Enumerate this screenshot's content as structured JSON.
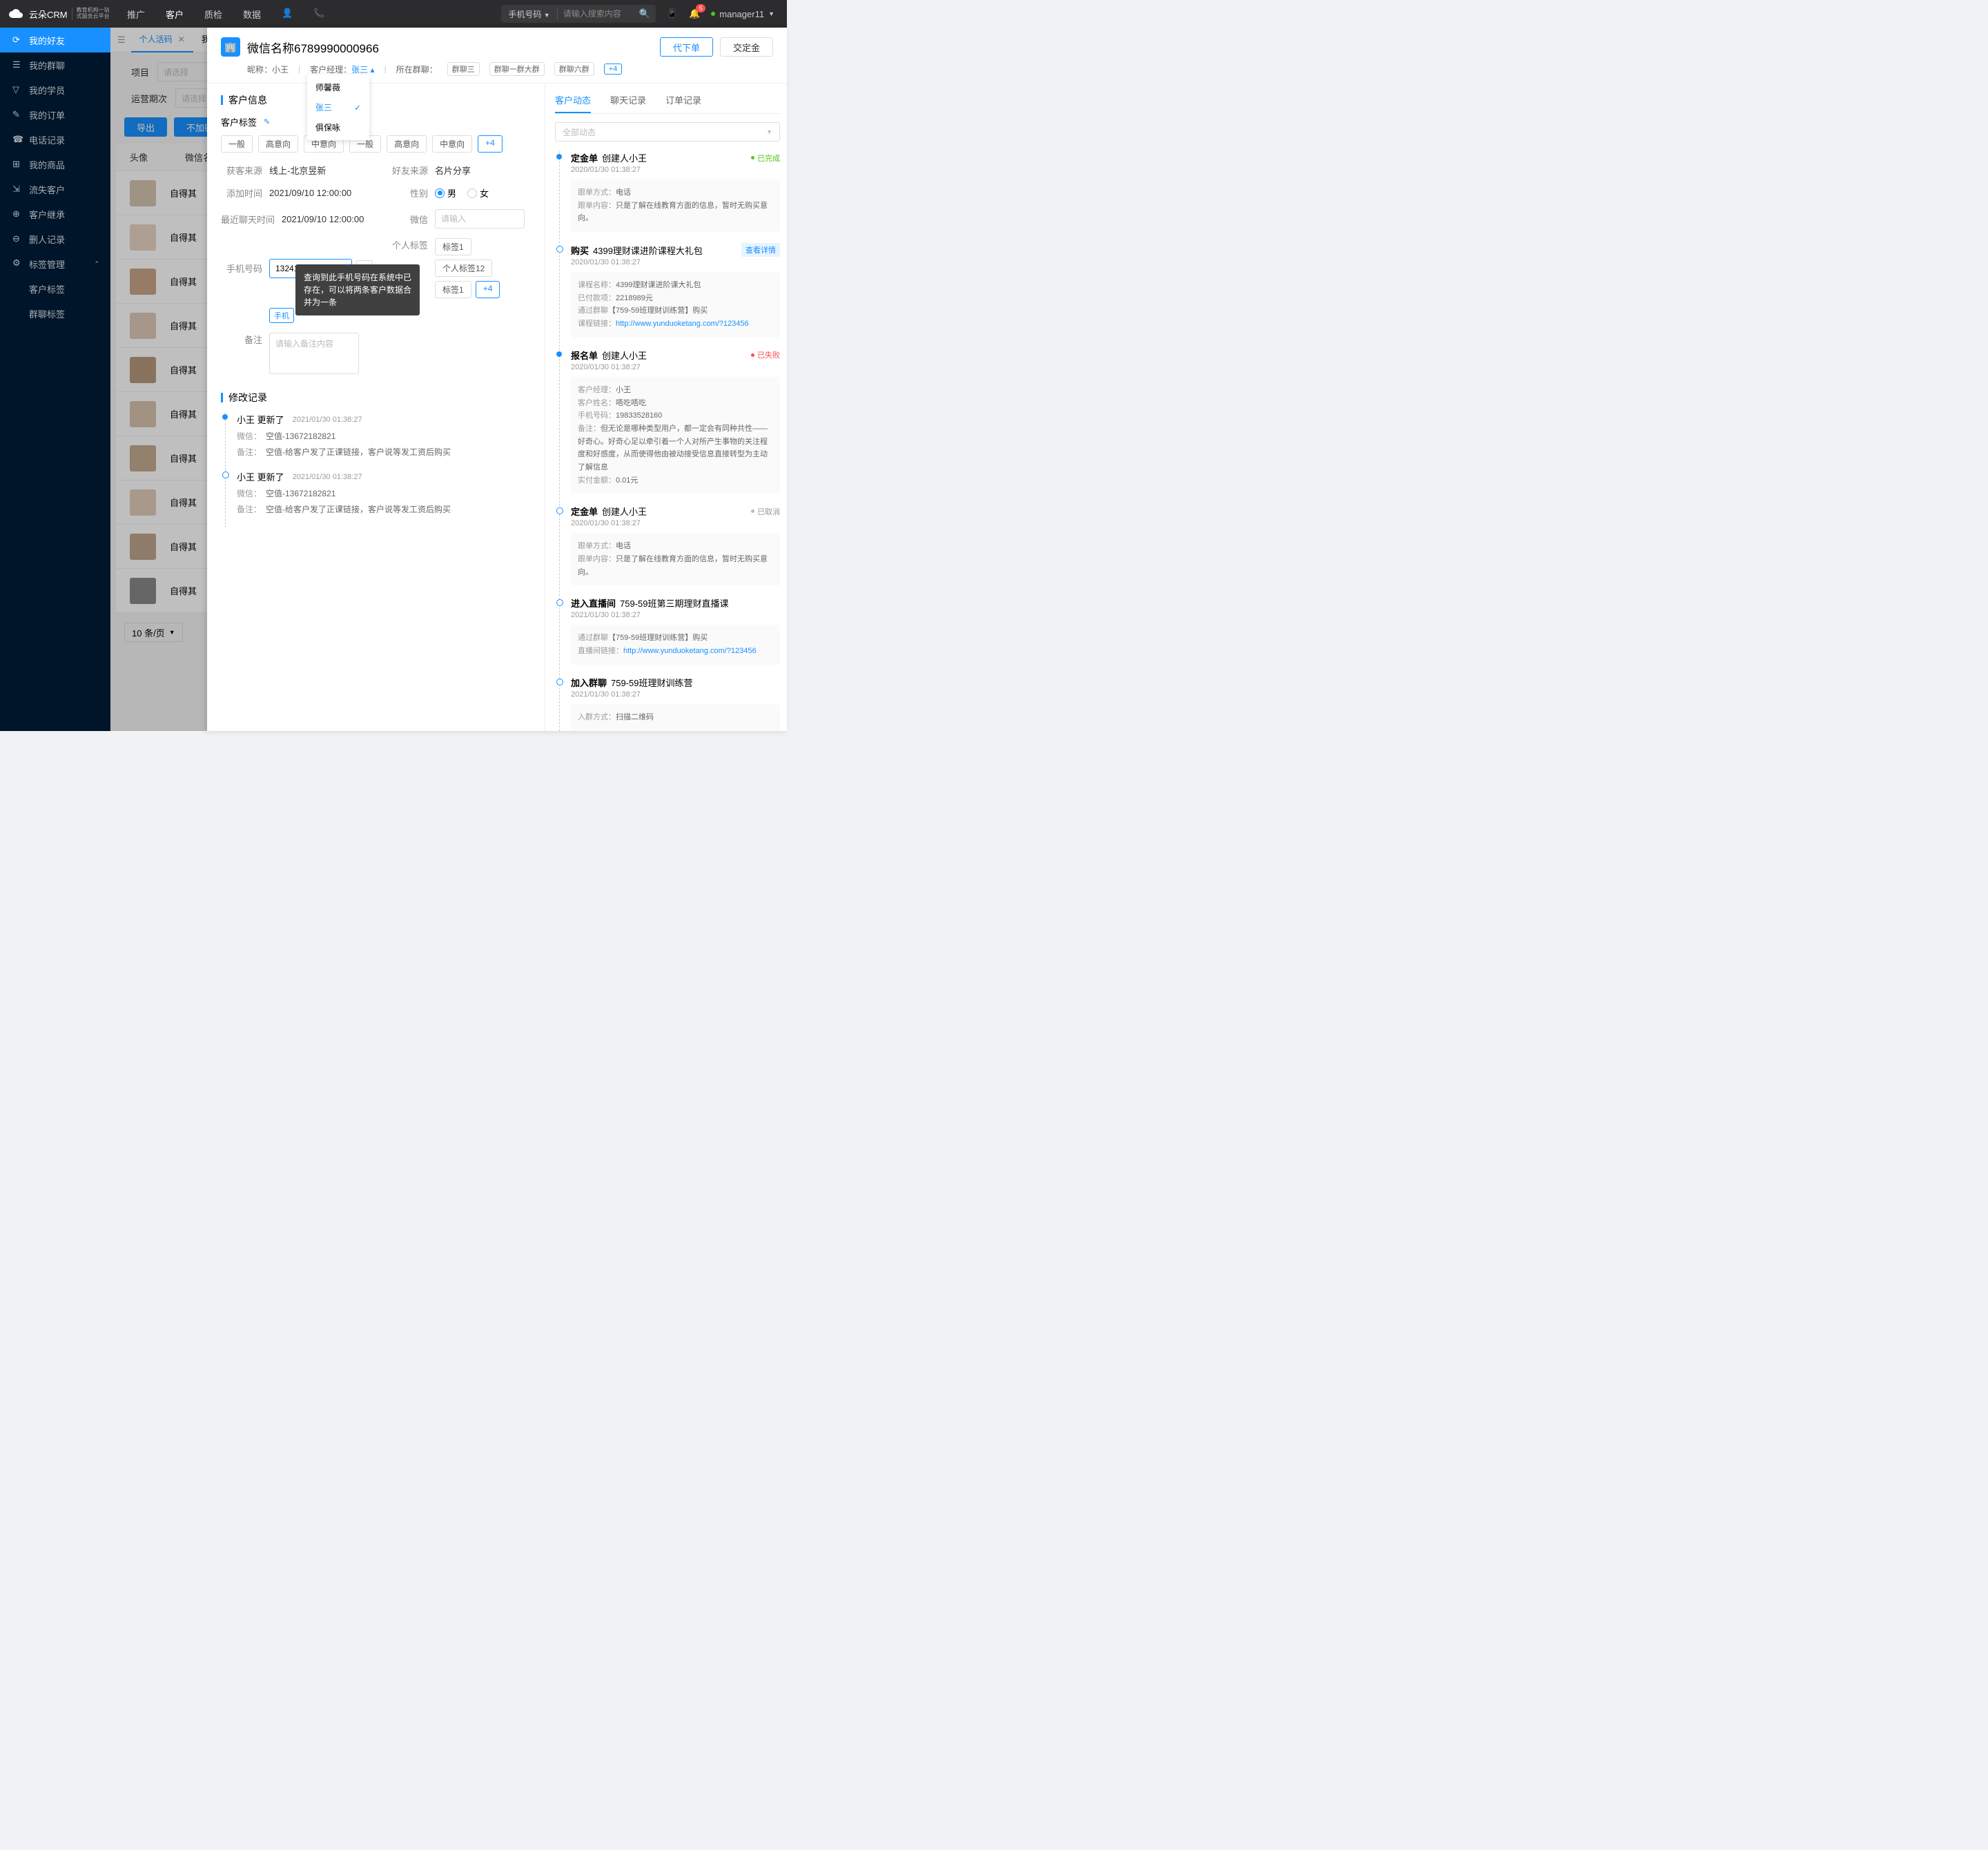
{
  "topbar": {
    "logo": "云朵CRM",
    "logo_sub1": "教育机构一站",
    "logo_sub2": "式服务云平台",
    "nav": [
      "推广",
      "客户",
      "质检",
      "数据"
    ],
    "nav_active": 1,
    "search_type": "手机号码",
    "search_placeholder": "请输入搜索内容",
    "badge": "5",
    "user": "manager11"
  },
  "sidebar": {
    "items": [
      {
        "label": "我的好友",
        "icon": "⟳",
        "active": true
      },
      {
        "label": "我的群聊",
        "icon": "☰"
      },
      {
        "label": "我的学员",
        "icon": "▽"
      },
      {
        "label": "我的订单",
        "icon": "✎"
      },
      {
        "label": "电话记录",
        "icon": "☎"
      },
      {
        "label": "我的商品",
        "icon": "⊞"
      },
      {
        "label": "流失客户",
        "icon": "⇲"
      },
      {
        "label": "客户继承",
        "icon": "⊕"
      },
      {
        "label": "删人记录",
        "icon": "⊖"
      },
      {
        "label": "标签管理",
        "icon": "⚙",
        "expand": true
      }
    ],
    "subs": [
      "客户标签",
      "群聊标签"
    ]
  },
  "tabs": {
    "active": "个人活码",
    "other": "我"
  },
  "filters": {
    "f1_label": "项目",
    "f2_label": "运营期次",
    "placeholder": "请选择"
  },
  "buttons": {
    "export": "导出",
    "unencrypted": "不加密导出"
  },
  "table": {
    "headers": [
      "头像",
      "微信名"
    ],
    "cell": "自得其",
    "page_size": "10 条/页"
  },
  "drawer": {
    "title": "微信名称6789990000966",
    "nickname_k": "昵称：",
    "nickname_v": "小王",
    "manager_k": "客户经理：",
    "manager_v": "张三",
    "groups_k": "所在群聊：",
    "groups": [
      "群聊三",
      "群聊一群大群",
      "群聊六群"
    ],
    "groups_more": "+4",
    "btn1": "代下单",
    "btn2": "交定金",
    "dropdown": [
      "师馨薇",
      "张三",
      "俱保咏"
    ],
    "dropdown_selected": 1
  },
  "info": {
    "section": "客户信息",
    "tags_k": "客户标签",
    "tags": [
      "一般",
      "高意向",
      "中意向",
      "一般",
      "高意向",
      "中意向"
    ],
    "tags_more": "+4",
    "source_k": "获客来源",
    "source_v": "线上-北京昱新",
    "friend_src_k": "好友来源",
    "friend_src_v": "名片分享",
    "add_time_k": "添加时间",
    "add_time_v": "2021/09/10 12:00:00",
    "gender_k": "性别",
    "gender_m": "男",
    "gender_f": "女",
    "chat_time_k": "最近聊天时间",
    "chat_time_v": "2021/09/10 12:00:00",
    "wechat_k": "微信",
    "wechat_ph": "请输入",
    "phone_k": "手机号码",
    "phone_v": "13241672152",
    "phone_btn": "手机",
    "personal_k": "个人标签",
    "personal_tags": [
      "标签1",
      "个人标签12",
      "标签1"
    ],
    "personal_more": "+4",
    "remark_k": "备注",
    "remark_ph": "请输入备注内容",
    "tooltip": "查询到此手机号码在系统中已存在，可以将两条客户数据合并为一条"
  },
  "modlog": {
    "section": "修改记录",
    "items": [
      {
        "who": "小王 更新了",
        "time": "2021/01/30  01:38:27",
        "lines": [
          {
            "k": "微信：",
            "v": "空值-13672182821"
          },
          {
            "k": "备注：",
            "v": "空值-给客户发了正课链接，客户说等发工资后购买"
          }
        ]
      },
      {
        "who": "小王 更新了",
        "time": "2021/01/30  01:38:27",
        "lines": [
          {
            "k": "微信：",
            "v": "空值-13672182821"
          },
          {
            "k": "备注：",
            "v": "空值-给客户发了正课链接，客户说等发工资后购买"
          }
        ]
      }
    ]
  },
  "right": {
    "tabs": [
      "客户动态",
      "聊天记录",
      "订单记录"
    ],
    "filter_ph": "全部动态",
    "items": [
      {
        "type": "filled",
        "title": "定金单",
        "sub": "创建人小王",
        "time": "2020/01/30  01:38:27",
        "status": "已完成",
        "status_color": "green",
        "card": [
          {
            "k": "跟单方式：",
            "v": "电话"
          },
          {
            "k": "跟单内容：",
            "v": "只是了解在线教育方面的信息，暂时无购买意向。"
          }
        ]
      },
      {
        "type": "hollow",
        "title": "购买",
        "sub": "4399理财课进阶课程大礼包",
        "time": "2020/01/30  01:38:27",
        "detail": "查看详情",
        "card": [
          {
            "k": "课程名称：",
            "v": "4399理财课进阶课大礼包"
          },
          {
            "k": "已付款项：",
            "v": "2218989元"
          },
          {
            "k": "通过群聊",
            "v": "【759-59班理财训练营】购买"
          },
          {
            "k": "课程链接：",
            "link": "http://www.yunduoketang.com/?123456"
          }
        ]
      },
      {
        "type": "filled",
        "title": "报名单",
        "sub": "创建人小王",
        "time": "2020/01/30  01:38:27",
        "status": "已失败",
        "status_color": "red",
        "card": [
          {
            "k": "客户经理：",
            "v": "小王"
          },
          {
            "k": "客户姓名：",
            "v": "唔吃唔吃"
          },
          {
            "k": "手机号码：",
            "v": "19833528160"
          },
          {
            "k": "备注：",
            "v": "但无论是哪种类型用户，都一定会有同种共性——好奇心。好奇心足以牵引着一个人对所产生事物的关注程度和好感度，从而使得他由被动接受信息直接转型为主动了解信息"
          },
          {
            "k": "实付金额：",
            "v": "0.01元"
          }
        ]
      },
      {
        "type": "hollow",
        "title": "定金单",
        "sub": "创建人小王",
        "time": "2020/01/30  01:38:27",
        "status": "已取消",
        "status_color": "gray",
        "card": [
          {
            "k": "跟单方式：",
            "v": "电话"
          },
          {
            "k": "跟单内容：",
            "v": "只是了解在线教育方面的信息，暂时无购买意向。"
          }
        ]
      },
      {
        "type": "hollow",
        "title": "进入直播间",
        "sub": "759-59班第三期理财直播课",
        "time": "2021/01/30  01:38:27",
        "card": [
          {
            "k": "通过群聊",
            "v": "【759-59班理财训练营】购买"
          },
          {
            "k": "直播间链接：",
            "link": "http://www.yunduoketang.com/?123456"
          }
        ]
      },
      {
        "type": "hollow",
        "title": "加入群聊",
        "sub": "759-59班理财训练营",
        "time": "2021/01/30  01:38:27",
        "card": [
          {
            "k": "入群方式：",
            "v": "扫描二维码"
          }
        ]
      }
    ]
  }
}
